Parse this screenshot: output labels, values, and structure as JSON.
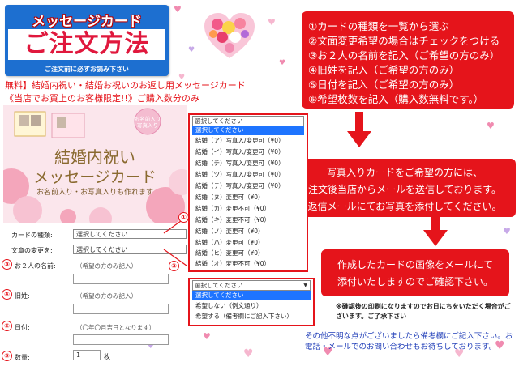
{
  "banner": {
    "top": "メッセージカード",
    "main": "ご注文方法",
    "sub": "ご注文前に必ずお読み下さい"
  },
  "steps": [
    "①カードの種類を一覧から選ぶ",
    "②文面変更希望の場合はチェックをつける",
    "③お２人の名前を記入（ご希望の方のみ）",
    "④旧姓を記入（ご希望の方のみ）",
    "⑤日付を記入（ご希望の方のみ）",
    "⑥希望枚数を記入（購入数無料です。）"
  ],
  "heading": {
    "line1": "無料】結婚内祝い・結婚お祝いのお返し用メッセージカード",
    "line2": "《当店でお買上のお客様限定!!》ご購入数分のみ"
  },
  "card_image": {
    "title1": "結婚内祝い",
    "title2": "メッセージカード",
    "sub": "お名前入り・お写真入りも作れます",
    "badge": "お名前入り 写真入り"
  },
  "photo_box": {
    "lines": [
      "写真入りカードをご希望の方には、",
      "注文後当店からメールを送信しております。",
      "返信メールにてお写真を添付してください。"
    ]
  },
  "confirm_box": {
    "lines": [
      "作成したカードの画像をメールにて",
      "添付いたしますのでご確認下さい。"
    ]
  },
  "form": {
    "card_type_label": "カードの種類:",
    "card_type_value": "選択してください",
    "text_change_label": "文章の変更を:",
    "text_change_value": "選択してください",
    "names_num": "③",
    "names_label": "お２人の名前:",
    "names_hint": "（希望の方のみ記入）",
    "maiden_num": "④",
    "maiden_label": "旧姓:",
    "maiden_hint": "（希望の方のみ記入）",
    "date_num": "⑤",
    "date_label": "日付:",
    "date_hint": "（〇年〇月吉日となります）",
    "qty_num": "⑥",
    "qty_label": "数量:",
    "qty_value": "1",
    "qty_unit": "枚"
  },
  "dropdown1": {
    "marker": "①",
    "header": "選択してください",
    "items": [
      "選択してください",
      "結婚（ア）写真入/変更可（¥0）",
      "結婚（イ）写真入/変更可（¥0）",
      "結婚（チ）写真入/変更可（¥0）",
      "結婚（ツ）写真入/変更可（¥0）",
      "結婚（テ）写真入/変更可（¥0）",
      "結婚（ヌ）変更可（¥0）",
      "結婚（カ）変更不可（¥0）",
      "結婚（キ）変更不可（¥0）",
      "結婚（ノ）変更可（¥0）",
      "結婚（ハ）変更可（¥0）",
      "結婚（ヒ）変更可（¥0）",
      "結婚（オ）変更不可（¥0）"
    ],
    "selected_index": 0
  },
  "dropdown2": {
    "marker": "②",
    "header": "選択してください",
    "items": [
      "選択してください",
      "希望しない（例文通り）",
      "希望する（備考欄にご記入下さい）"
    ],
    "selected_index": 0
  },
  "notice": "※確認後の印刷になりますのでお日にちをいただく場合がございます。ご了承下さい",
  "footer": "その他不明な点がございましたら備考欄にご記入下さい。お電話・メールでのお問い合わせもお待ちしております。",
  "colors": {
    "accent_red": "#e5141b",
    "banner_blue": "#1d6fd0",
    "select_blue": "#1e74ff",
    "footer_blue": "#1f3db8"
  }
}
